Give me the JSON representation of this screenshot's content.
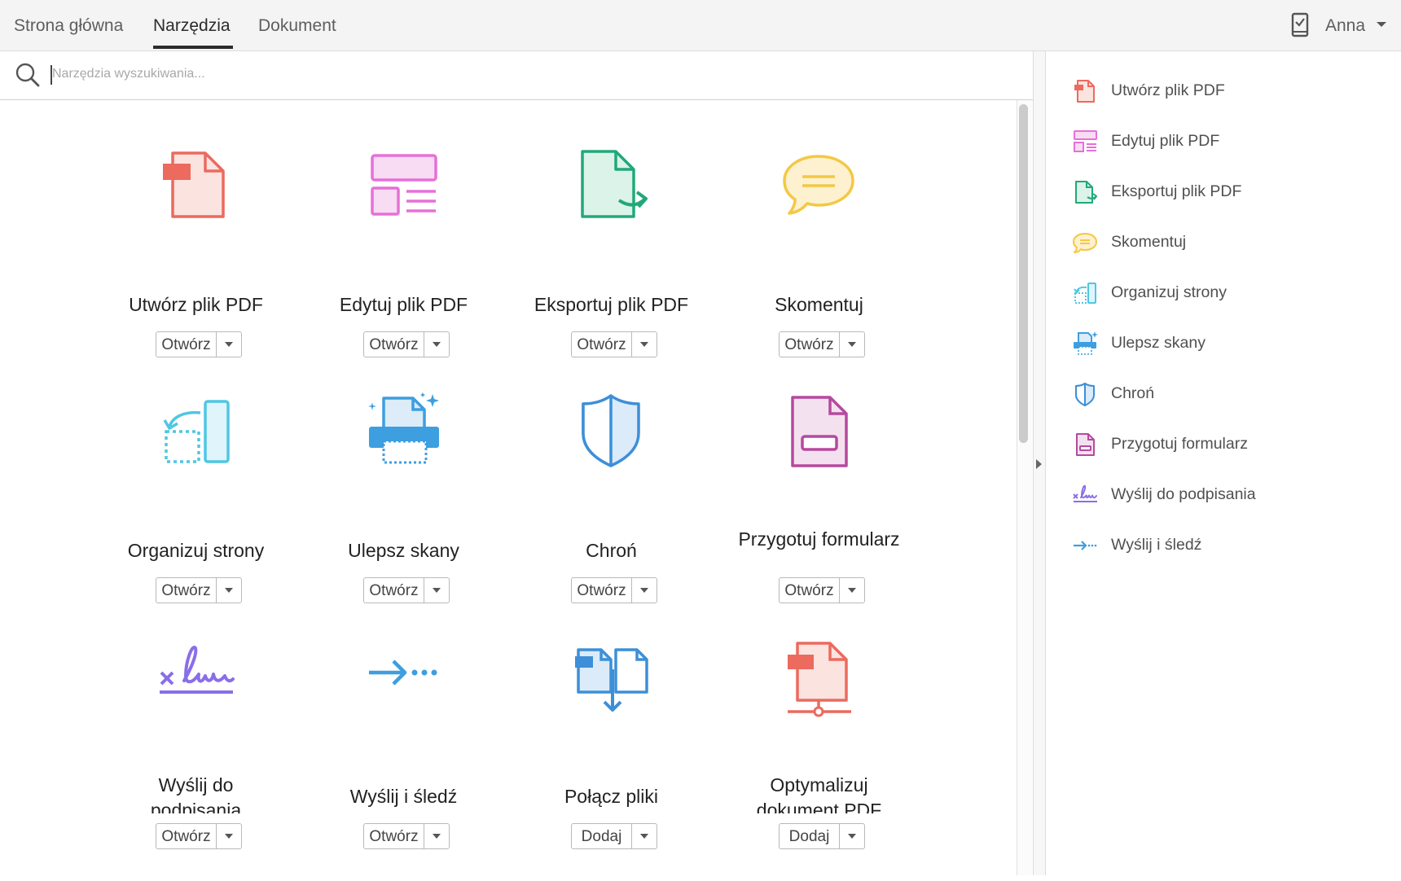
{
  "header": {
    "tabs": [
      {
        "label": "Strona główna"
      },
      {
        "label": "Narzędzia"
      },
      {
        "label": "Dokument"
      }
    ],
    "active_tab": "Narzędzia",
    "user_name": "Anna"
  },
  "search": {
    "placeholder": "Narzędzia wyszukiwania..."
  },
  "tools": [
    {
      "label": "Utwórz plik PDF",
      "button": "Otwórz",
      "icon": "create-pdf-icon",
      "color": "#ec6a5e"
    },
    {
      "label": "Edytuj plik PDF",
      "button": "Otwórz",
      "icon": "edit-pdf-icon",
      "color": "#e671d7"
    },
    {
      "label": "Eksportuj plik PDF",
      "button": "Otwórz",
      "icon": "export-pdf-icon",
      "color": "#22a87a"
    },
    {
      "label": "Skomentuj",
      "button": "Otwórz",
      "icon": "comment-icon",
      "color": "#f3c845"
    },
    {
      "label": "Organizuj strony",
      "button": "Otwórz",
      "icon": "organize-pages-icon",
      "color": "#4fc6e3"
    },
    {
      "label": "Ulepsz skany",
      "button": "Otwórz",
      "icon": "enhance-scans-icon",
      "color": "#3d9ee0"
    },
    {
      "label": "Chroń",
      "button": "Otwórz",
      "icon": "protect-shield-icon",
      "color": "#3d8fd8"
    },
    {
      "label": "Przygotuj formularz",
      "button": "Otwórz",
      "icon": "prepare-form-icon",
      "color": "#b54a9e"
    },
    {
      "label_line1": "Wyślij do",
      "label_line2": "podpisania",
      "button": "Otwórz",
      "icon": "send-for-signature-icon",
      "color": "#8a6ee8"
    },
    {
      "label": "Wyślij i śledź",
      "button": "Otwórz",
      "icon": "send-and-track-icon",
      "color": "#3d9ee0"
    },
    {
      "label": "Połącz pliki",
      "button": "Dodaj",
      "icon": "combine-files-icon",
      "color": "#3d8fd8"
    },
    {
      "label_line1": "Optymalizuj",
      "label_line2": "dokument PDF",
      "button": "Dodaj",
      "icon": "optimize-pdf-icon",
      "color": "#ec6a5e"
    }
  ],
  "right_panel": {
    "items": [
      {
        "label": "Utwórz plik PDF",
        "icon": "create-pdf-icon"
      },
      {
        "label": "Edytuj plik PDF",
        "icon": "edit-pdf-icon"
      },
      {
        "label": "Eksportuj plik PDF",
        "icon": "export-pdf-icon"
      },
      {
        "label": "Skomentuj",
        "icon": "comment-icon"
      },
      {
        "label": "Organizuj strony",
        "icon": "organize-pages-icon"
      },
      {
        "label": "Ulepsz skany",
        "icon": "enhance-scans-icon"
      },
      {
        "label": "Chroń",
        "icon": "protect-shield-icon"
      },
      {
        "label": "Przygotuj formularz",
        "icon": "prepare-form-icon"
      },
      {
        "label": "Wyślij do podpisania",
        "icon": "send-for-signature-icon"
      },
      {
        "label": "Wyślij i śledź",
        "icon": "send-and-track-icon"
      }
    ]
  }
}
